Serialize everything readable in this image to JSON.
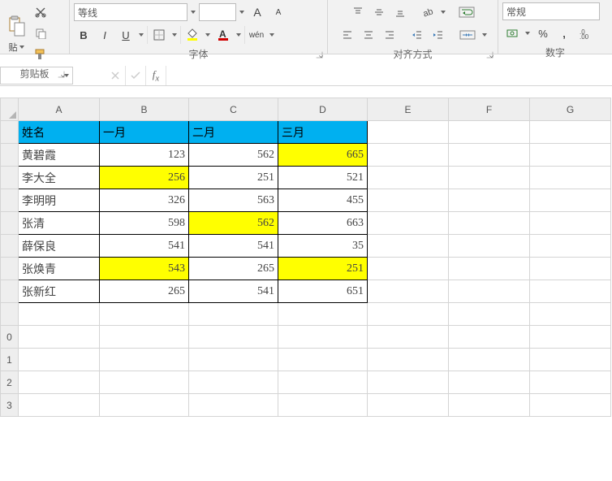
{
  "ribbon": {
    "paste_label": "贴",
    "clipboard_group": "剪贴板",
    "font_group": "字体",
    "align_group": "对齐方式",
    "number_group": "数字",
    "font_name": "等线",
    "font_size": "",
    "bold": "B",
    "italic": "I",
    "underline": "U",
    "phonetic": "wén",
    "number_format": "常规",
    "percent": "%",
    "comma": ",",
    "A_big": "A",
    "A_small": "A"
  },
  "name_box": "",
  "formula": "",
  "columns": [
    "",
    "A",
    "B",
    "C",
    "D",
    "E",
    "F",
    "G"
  ],
  "row_labels": [
    "",
    "",
    "",
    "",
    "",
    "",
    "",
    "",
    "",
    "0",
    "1",
    "2",
    "3"
  ],
  "headers": {
    "c0": "姓名",
    "c1": "一月",
    "c2": "二月",
    "c3": "三月"
  },
  "rows": [
    {
      "name": "黄碧霞",
      "m1": "123",
      "m2": "562",
      "m3": "665",
      "hl": {
        "m3": true
      }
    },
    {
      "name": "李大全",
      "m1": "256",
      "m2": "251",
      "m3": "521",
      "hl": {
        "m1": true
      }
    },
    {
      "name": "李明明",
      "m1": "326",
      "m2": "563",
      "m3": "455",
      "hl": {}
    },
    {
      "name": "张清",
      "m1": "598",
      "m2": "562",
      "m3": "663",
      "hl": {
        "m2": true
      }
    },
    {
      "name": "薛保良",
      "m1": "541",
      "m2": "541",
      "m3": "35",
      "hl": {}
    },
    {
      "name": "张焕青",
      "m1": "543",
      "m2": "265",
      "m3": "251",
      "hl": {
        "m1": true,
        "m3": true
      }
    },
    {
      "name": "张新红",
      "m1": "265",
      "m2": "541",
      "m3": "651",
      "hl": {}
    }
  ],
  "chart_data": {
    "type": "table",
    "title": "",
    "columns": [
      "姓名",
      "一月",
      "二月",
      "三月"
    ],
    "data": [
      [
        "黄碧霞",
        123,
        562,
        665
      ],
      [
        "李大全",
        256,
        251,
        521
      ],
      [
        "李明明",
        326,
        563,
        455
      ],
      [
        "张清",
        598,
        562,
        663
      ],
      [
        "薛保良",
        541,
        541,
        35
      ],
      [
        "张焕青",
        543,
        265,
        251
      ],
      [
        "张新红",
        265,
        541,
        651
      ]
    ],
    "highlighted_cells": [
      [
        0,
        3
      ],
      [
        1,
        1
      ],
      [
        3,
        2
      ],
      [
        5,
        1
      ],
      [
        5,
        3
      ]
    ]
  }
}
